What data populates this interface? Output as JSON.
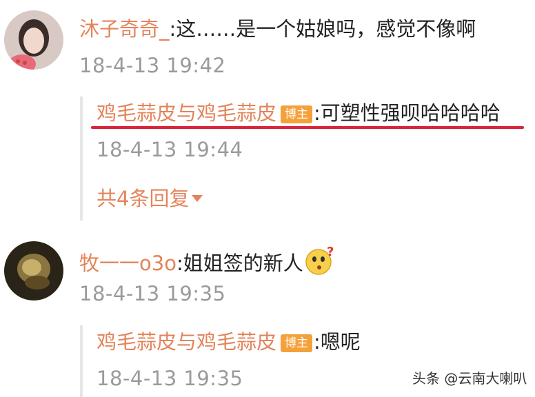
{
  "comments": [
    {
      "username": "沐子奇奇_",
      "text": ":这……是一个姑娘吗，感觉不像啊",
      "time": "18-4-13 19:42",
      "reply": {
        "username": "鸡毛蒜皮与鸡毛蒜皮",
        "badge": "博主",
        "text": ":可塑性强呗哈哈哈哈",
        "time": "18-4-13 19:44"
      },
      "more_replies": "共4条回复"
    },
    {
      "username": "牧一一o3o",
      "text": ":姐姐签的新人",
      "emoji": "thinking-face-icon",
      "time": "18-4-13 19:35",
      "reply": {
        "username": "鸡毛蒜皮与鸡毛蒜皮",
        "badge": "博主",
        "text": ":嗯呢",
        "time": "18-4-13 19:35"
      }
    }
  ],
  "watermark": "头条 @云南大喇叭",
  "colors": {
    "username": "#e3845a",
    "badge": "#f5a13b",
    "timestamp": "#9a9a9a",
    "highlight_underline": "#d9233a"
  }
}
